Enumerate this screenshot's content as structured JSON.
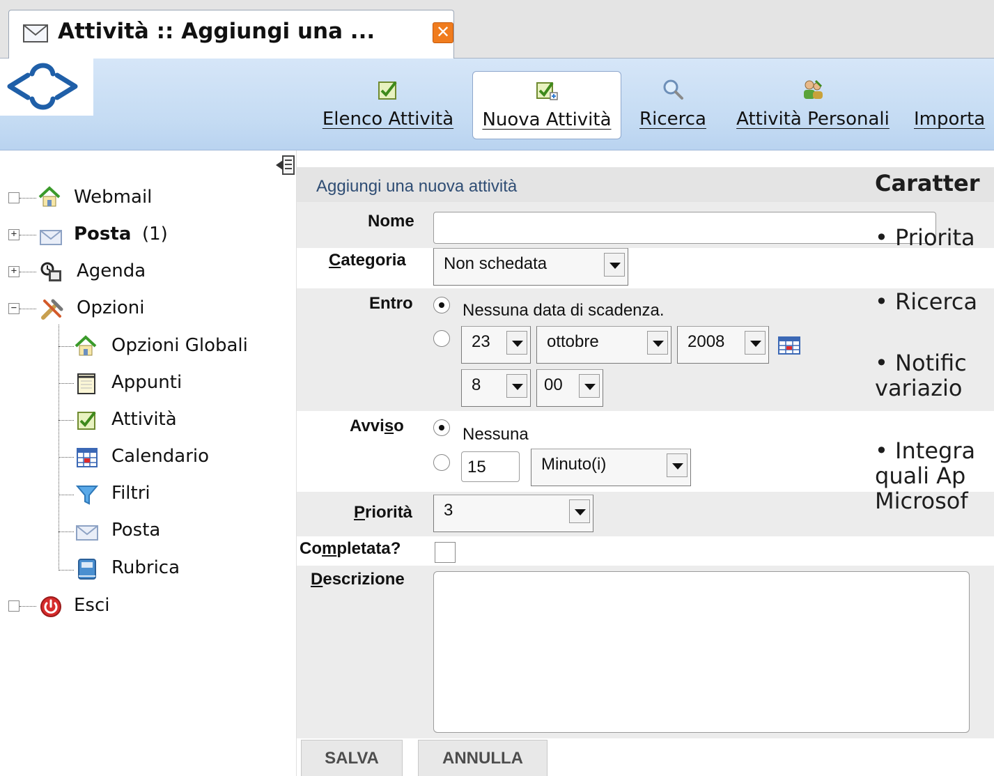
{
  "tab": {
    "title": "Attività :: Aggiungi una ...",
    "close_glyph": "✕",
    "icon": "envelope-icon"
  },
  "toolbar": {
    "logo": "app-logo",
    "buttons": [
      {
        "label": "Elenco Attività",
        "icon": "tasks-icon",
        "active": false
      },
      {
        "label": "Nuova Attività",
        "icon": "new-task-icon",
        "active": true
      },
      {
        "label": "Ricerca",
        "icon": "magnifier-icon",
        "active": false
      },
      {
        "label": "Attività Personali",
        "icon": "users-icon",
        "active": false
      },
      {
        "label": "Importa",
        "icon": "import-icon",
        "active": false
      }
    ]
  },
  "sidebar": {
    "items": [
      {
        "label": "Webmail",
        "icon": "home-icon",
        "expander": ""
      },
      {
        "label": "Posta",
        "count": "(1)",
        "icon": "envelope-icon",
        "expander": "+"
      },
      {
        "label": "Agenda",
        "icon": "agenda-icon",
        "expander": "+"
      },
      {
        "label": "Opzioni",
        "icon": "tools-icon",
        "expander": "−"
      },
      {
        "label": "Opzioni Globali",
        "icon": "home-icon"
      },
      {
        "label": "Appunti",
        "icon": "notepad-icon"
      },
      {
        "label": "Attività",
        "icon": "tasks-icon"
      },
      {
        "label": "Calendario",
        "icon": "calendar-icon"
      },
      {
        "label": "Filtri",
        "icon": "funnel-icon"
      },
      {
        "label": "Posta",
        "icon": "envelope-icon"
      },
      {
        "label": "Rubrica",
        "icon": "address-book-icon"
      },
      {
        "label": "Esci",
        "icon": "power-icon",
        "expander": ""
      }
    ]
  },
  "form": {
    "title": "Aggiungi una nuova attività",
    "nome_label": "Nome",
    "nome_value": "",
    "categoria_label_u": "C",
    "categoria_label_rest": "ategoria",
    "categoria_value": "Non schedata",
    "entro_label": "Entro",
    "entro_option_none": "Nessuna data di scadenza.",
    "entro_selected": "none",
    "date_day": "23",
    "date_month": "ottobre",
    "date_year": "2008",
    "time_hour": "8",
    "time_minute": "00",
    "avviso_label_pre": "Avvi",
    "avviso_label_u": "s",
    "avviso_label_post": "o",
    "avviso_option_none": "Nessuna",
    "avviso_selected": "none",
    "avviso_amount": "15",
    "avviso_unit": "Minuto(i)",
    "priorita_label_u": "P",
    "priorita_label_rest": "riorità",
    "priorita_value": "3",
    "completata_label_pre": "Co",
    "completata_label_u": "m",
    "completata_label_post": "pletata?",
    "completata_checked": false,
    "descrizione_label_u": "D",
    "descrizione_label_rest": "escrizione",
    "descrizione_value": "",
    "save_label": "SALVA",
    "cancel_label": "ANNULLA"
  },
  "overlay": {
    "heading": "Caratter",
    "lines": [
      "• Priorita",
      "• Ricerca",
      "• Notific",
      "variazio",
      "• Integra",
      "quali Ap",
      "Microsof"
    ]
  }
}
